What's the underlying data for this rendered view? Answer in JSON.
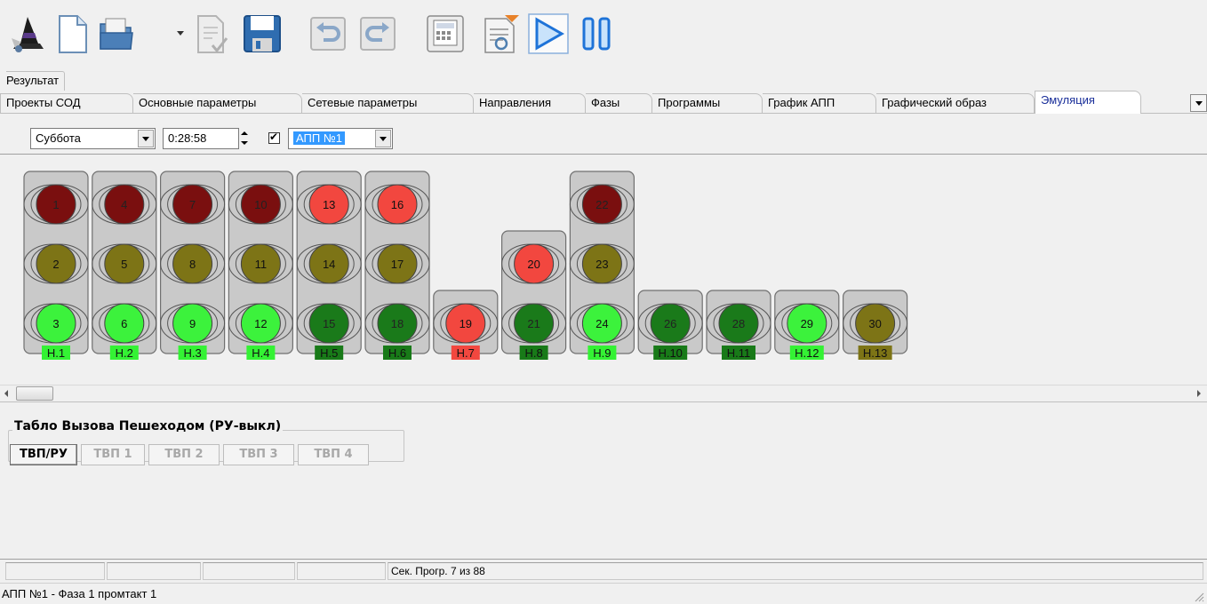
{
  "tabs": {
    "upper_row": [
      "Результат"
    ],
    "lower_row": [
      "Проекты СОД",
      "Основные параметры",
      "Сетевые параметры",
      "Направления",
      "Фазы",
      "Программы",
      "График АПП",
      "Графический образ",
      "Эмуляция"
    ],
    "active": "Эмуляция"
  },
  "controls": {
    "day": "Суббота",
    "time": "0:28:58",
    "checkbox_checked": true,
    "app_select": "АПП №1"
  },
  "signal_heads": [
    {
      "label": "Н.1",
      "label_color": "#34f234",
      "lamps": [
        {
          "n": "1",
          "color": "#7a0f0f"
        },
        {
          "n": "2",
          "color": "#7d7416"
        },
        {
          "n": "3",
          "color": "#3cf23c"
        }
      ]
    },
    {
      "label": "Н.2",
      "label_color": "#34f234",
      "lamps": [
        {
          "n": "4",
          "color": "#7a0f0f"
        },
        {
          "n": "5",
          "color": "#7d7416"
        },
        {
          "n": "6",
          "color": "#3cf23c"
        }
      ]
    },
    {
      "label": "Н.3",
      "label_color": "#34f234",
      "lamps": [
        {
          "n": "7",
          "color": "#7a0f0f"
        },
        {
          "n": "8",
          "color": "#7d7416"
        },
        {
          "n": "9",
          "color": "#3cf23c"
        }
      ]
    },
    {
      "label": "Н.4",
      "label_color": "#34f234",
      "lamps": [
        {
          "n": "10",
          "color": "#7a0f0f"
        },
        {
          "n": "11",
          "color": "#7d7416"
        },
        {
          "n": "12",
          "color": "#3cf23c"
        }
      ]
    },
    {
      "label": "Н.5",
      "label_color": "#187a18",
      "lamps": [
        {
          "n": "13",
          "color": "#f2473f"
        },
        {
          "n": "14",
          "color": "#7d7416"
        },
        {
          "n": "15",
          "color": "#1a7a1a"
        }
      ]
    },
    {
      "label": "Н.6",
      "label_color": "#187a18",
      "lamps": [
        {
          "n": "16",
          "color": "#f2473f"
        },
        {
          "n": "17",
          "color": "#7d7416"
        },
        {
          "n": "18",
          "color": "#1a7a1a"
        }
      ]
    },
    {
      "label": "Н.7",
      "label_color": "#f2473f",
      "lamps": [
        {
          "n": "19",
          "color": "#f2473f"
        }
      ]
    },
    {
      "label": "Н.8",
      "label_color": "#187a18",
      "lamps": [
        {
          "n": "20",
          "color": "#f2473f"
        },
        {
          "n": "21",
          "color": "#1a7a1a"
        }
      ]
    },
    {
      "label": "Н.9",
      "label_color": "#34f234",
      "lamps": [
        {
          "n": "22",
          "color": "#7a0f0f"
        },
        {
          "n": "23",
          "color": "#7d7416"
        },
        {
          "n": "24",
          "color": "#3cf23c"
        }
      ]
    },
    {
      "label": "Н.10",
      "label_color": "#187a18",
      "lamps": [
        {
          "n": "26",
          "color": "#1a7a1a"
        }
      ]
    },
    {
      "label": "Н.11",
      "label_color": "#187a18",
      "lamps": [
        {
          "n": "28",
          "color": "#1a7a1a"
        }
      ]
    },
    {
      "label": "Н.12",
      "label_color": "#34f234",
      "lamps": [
        {
          "n": "29",
          "color": "#3cf23c"
        }
      ]
    },
    {
      "label": "Н.13",
      "label_color": "#7d7416",
      "lamps": [
        {
          "n": "30",
          "color": "#7d7416"
        }
      ]
    }
  ],
  "pedestrian_panel": {
    "title": "Табло Вызова Пешеходом (РУ-выкл)",
    "buttons": [
      {
        "label": "ТВП/РУ",
        "enabled": true
      },
      {
        "label": "ТВП 1",
        "enabled": false
      },
      {
        "label": "ТВП 2",
        "enabled": false
      },
      {
        "label": "ТВП 3",
        "enabled": false
      },
      {
        "label": "ТВП 4",
        "enabled": false
      }
    ]
  },
  "status": {
    "program": "Сек. Прогр. 7 из 88",
    "bottom": "АПП №1 -  Фаза 1 промтакт 1"
  },
  "icons": [
    "wizard-icon",
    "new-document-icon",
    "open-folder-icon",
    "dropdown-arrow-icon",
    "edit-document-icon",
    "save-icon",
    "undo-icon",
    "redo-icon",
    "calculator-icon",
    "report-icon",
    "play-icon",
    "pause-icon"
  ]
}
